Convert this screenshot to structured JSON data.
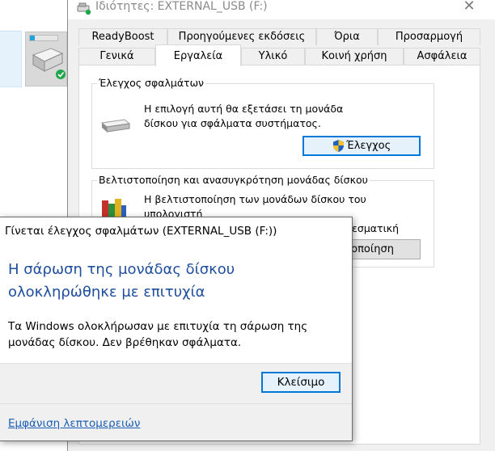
{
  "window": {
    "title": "Ιδιότητες: EXTERNAL_USB (F:)",
    "close_glyph": "✕"
  },
  "tabs": {
    "row1": [
      "ReadyBoost",
      "Προηγούμενες εκδόσεις",
      "Όρια",
      "Προσαρμογή"
    ],
    "row2": [
      "Γενικά",
      "Εργαλεία",
      "Υλικό",
      "Κοινή χρήση",
      "Ασφάλεια"
    ],
    "active": "Εργαλεία"
  },
  "error_check": {
    "label": "Έλεγχος σφαλμάτων",
    "description_line1": "Η επιλογή αυτή θα εξετάσει τη μονάδα",
    "description_line2": "δίσκου για σφάλματα συστήματος.",
    "button": "Έλεγχος"
  },
  "optimize": {
    "label": "Βελτιστοποίηση και ανασυγκρότηση μονάδας δίσκου",
    "description_line1": "Η βελτιστοποίηση των μονάδων δίσκου του υπολογιστή",
    "description_line2": "σας μπορεί να συμβάλει στην πιο αποτελεσματική",
    "button_partial": "ιοποίηση"
  },
  "dialog": {
    "title": "Γίνεται έλεγχος σφαλμάτων (EXTERNAL_USB (F:))",
    "heading": "Η σάρωση της μονάδας δίσκου ολοκληρώθηκε με επιτυχία",
    "body": "Τα Windows ολοκλήρωσαν με επιτυχία τη σάρωση της μονάδας δίσκου. Δεν βρέθηκαν σφάλματα.",
    "close_button": "Κλείσιμο",
    "details_link": "Εμφάνιση λεπτομερειών"
  },
  "colors": {
    "accent": "#0078d7",
    "heading": "#1e4e9c",
    "link": "#1a5fb4"
  }
}
